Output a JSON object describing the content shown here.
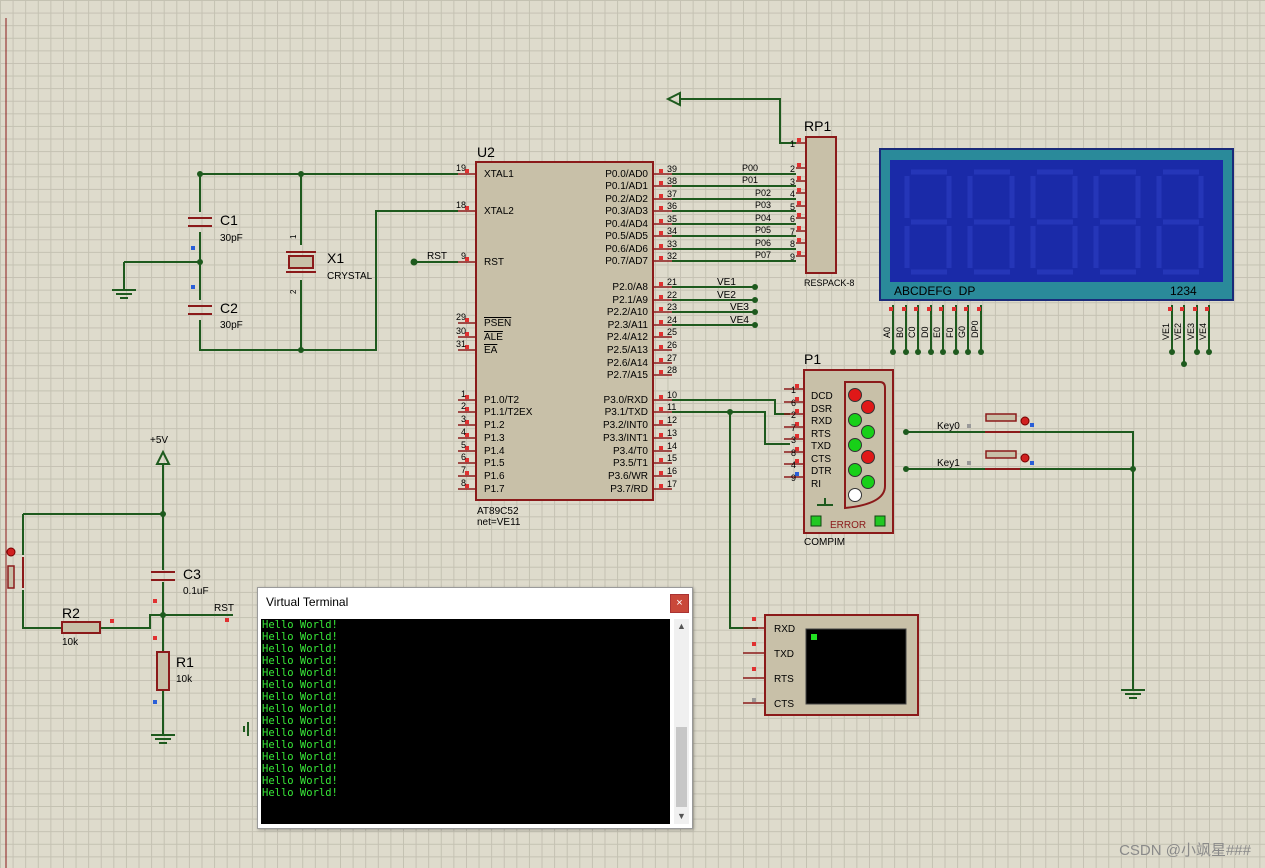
{
  "colors": {
    "wire": "#1e5a1e",
    "body": "#c8c0a8",
    "outline": "#8b1a1a",
    "pin": "#e03030",
    "label": "#000000",
    "lcd": "#1a2aa8",
    "lcd_frame": "#2a8a9a"
  },
  "u2": {
    "ref": "U2",
    "part": "AT89C52",
    "net": "net=VE11",
    "left_pins": [
      {
        "num": "19",
        "name": "XTAL1"
      },
      {
        "num": "18",
        "name": "XTAL2"
      },
      {
        "num": "9",
        "name": "RST"
      },
      {
        "num": "29",
        "name": "PSEN"
      },
      {
        "num": "30",
        "name": "ALE"
      },
      {
        "num": "31",
        "name": "EA"
      },
      {
        "num": "1",
        "name": "P1.0/T2"
      },
      {
        "num": "2",
        "name": "P1.1/T2EX"
      },
      {
        "num": "3",
        "name": "P1.2"
      },
      {
        "num": "4",
        "name": "P1.3"
      },
      {
        "num": "5",
        "name": "P1.4"
      },
      {
        "num": "6",
        "name": "P1.5"
      },
      {
        "num": "7",
        "name": "P1.6"
      },
      {
        "num": "8",
        "name": "P1.7"
      }
    ],
    "right_pins": [
      {
        "num": "39",
        "name": "P0.0/AD0"
      },
      {
        "num": "38",
        "name": "P0.1/AD1"
      },
      {
        "num": "37",
        "name": "P0.2/AD2"
      },
      {
        "num": "36",
        "name": "P0.3/AD3"
      },
      {
        "num": "35",
        "name": "P0.4/AD4"
      },
      {
        "num": "34",
        "name": "P0.5/AD5"
      },
      {
        "num": "33",
        "name": "P0.6/AD6"
      },
      {
        "num": "32",
        "name": "P0.7/AD7"
      },
      {
        "num": "21",
        "name": "P2.0/A8"
      },
      {
        "num": "22",
        "name": "P2.1/A9"
      },
      {
        "num": "23",
        "name": "P2.2/A10"
      },
      {
        "num": "24",
        "name": "P2.3/A11"
      },
      {
        "num": "25",
        "name": "P2.4/A12"
      },
      {
        "num": "26",
        "name": "P2.5/A13"
      },
      {
        "num": "27",
        "name": "P2.6/A14"
      },
      {
        "num": "28",
        "name": "P2.7/A15"
      },
      {
        "num": "10",
        "name": "P3.0/RXD"
      },
      {
        "num": "11",
        "name": "P3.1/TXD"
      },
      {
        "num": "12",
        "name": "P3.2/INT0"
      },
      {
        "num": "13",
        "name": "P3.3/INT1"
      },
      {
        "num": "14",
        "name": "P3.4/T0"
      },
      {
        "num": "15",
        "name": "P3.5/T1"
      },
      {
        "num": "16",
        "name": "P3.6/WR"
      },
      {
        "num": "17",
        "name": "P3.7/RD"
      }
    ],
    "rst_net": "RST"
  },
  "p0_nets": [
    "P00",
    "P01",
    "P02",
    "P03",
    "P04",
    "P05",
    "P06",
    "P07"
  ],
  "ve_nets": [
    "VE1",
    "VE2",
    "VE3",
    "VE4"
  ],
  "rp1": {
    "ref": "RP1",
    "part": "RESPACK-8",
    "pins": [
      "1",
      "2",
      "3",
      "4",
      "5",
      "6",
      "7",
      "8",
      "9"
    ]
  },
  "lcd": {
    "segments": "ABCDEFG  DP",
    "digits": "1234",
    "bottom_pins": [
      "A0",
      "B0",
      "C0",
      "D0",
      "E0",
      "F0",
      "G0",
      "DP0"
    ],
    "ve_pins": [
      "VE1",
      "VE2",
      "VE3",
      "VE4"
    ]
  },
  "c1": {
    "ref": "C1",
    "value": "30pF"
  },
  "c2": {
    "ref": "C2",
    "value": "30pF"
  },
  "x1": {
    "ref": "X1",
    "part": "CRYSTAL",
    "pin1": "1",
    "pin2": "2"
  },
  "p1": {
    "ref": "P1",
    "part": "COMPIM",
    "error": "ERROR",
    "pins": [
      {
        "num": "1",
        "name": "DCD"
      },
      {
        "num": "6",
        "name": "DSR"
      },
      {
        "num": "2",
        "name": "RXD"
      },
      {
        "num": "7",
        "name": "RTS"
      },
      {
        "num": "3",
        "name": "TXD"
      },
      {
        "num": "8",
        "name": "CTS"
      },
      {
        "num": "4",
        "name": "DTR"
      },
      {
        "num": "9",
        "name": "RI"
      }
    ],
    "leds": [
      "red",
      "red",
      "green",
      "green",
      "green",
      "red",
      "green",
      "green",
      "off"
    ]
  },
  "keys": [
    "Key0",
    "Key1"
  ],
  "vt": {
    "pins": [
      "RXD",
      "TXD",
      "RTS",
      "CTS"
    ]
  },
  "power": {
    "label": "+5V"
  },
  "c3": {
    "ref": "C3",
    "value": "0.1uF"
  },
  "r2": {
    "ref": "R2",
    "value": "10k"
  },
  "r1": {
    "ref": "R1",
    "value": "10k"
  },
  "rst_net": "RST",
  "terminal": {
    "title": "Virtual Terminal",
    "close": "×",
    "lines": [
      "Hello World!",
      "Hello World!",
      "Hello World!",
      "Hello World!",
      "Hello World!",
      "Hello World!",
      "Hello World!",
      "Hello World!",
      "Hello World!",
      "Hello World!",
      "Hello World!",
      "Hello World!",
      "Hello World!",
      "Hello World!",
      "Hello World!"
    ]
  },
  "watermark": "CSDN @小飒星###"
}
